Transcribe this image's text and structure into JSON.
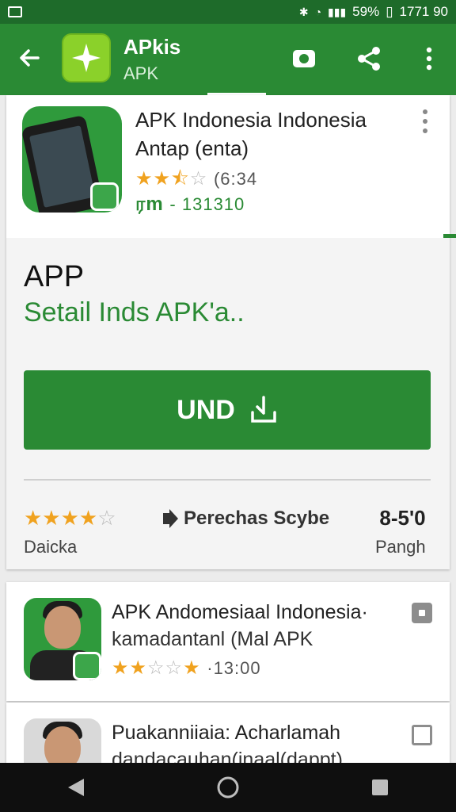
{
  "status_bar": {
    "battery": "59%",
    "time": "1771 90"
  },
  "app_bar": {
    "title": "APkis",
    "subtitle": "APK"
  },
  "featured_app": {
    "title_line1": "APK Indonesia Indonesia",
    "title_line2": "Antap (enta)",
    "rating_stars": 2.5,
    "rating_count": "(6:34",
    "downloads_badge": "ரm",
    "downloads_count": "- 131310"
  },
  "details": {
    "heading": "APP",
    "subheading": "Setail Inds APK'a..",
    "install_label": "UND"
  },
  "stats": {
    "rating_stars": 4,
    "rating_label": "Daicka",
    "category_label": "Perechas Scybe",
    "size_value": "8-5'0",
    "size_label": "Pangh"
  },
  "list": [
    {
      "title": "APK Andomesiaal Indonesia·",
      "subtitle": "kamadantanl (Mal APK",
      "rating_stars": 2.5,
      "meta": "·13:00"
    },
    {
      "title": "Puakanniiaia: Acharlamah",
      "subtitle": "dandacauhan(inaal(dappt)"
    }
  ],
  "colors": {
    "primary": "#2a8a34",
    "status_bar": "#1e6b2a",
    "star": "#f0a21f"
  },
  "icons": [
    "back-arrow-icon",
    "app-logo-icon",
    "camera-icon",
    "share-icon",
    "more-vert-icon",
    "download-icon",
    "play-arrow-icon",
    "nav-back-icon",
    "nav-home-icon",
    "nav-recents-icon"
  ]
}
